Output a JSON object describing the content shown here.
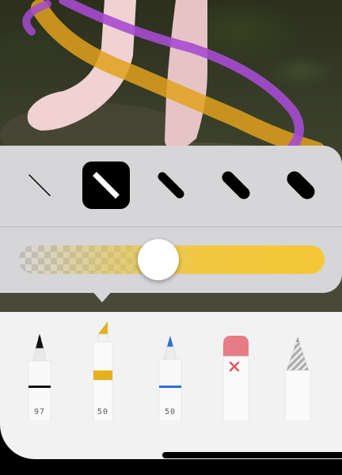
{
  "canvas": {
    "background": "photo-of-bare-feet-on-grass",
    "strokes": [
      {
        "name": "yellow-highlighter-stroke",
        "color": "#e0a21c"
      },
      {
        "name": "purple-marker-stroke",
        "color": "#a64bd2"
      }
    ]
  },
  "popover": {
    "widths": [
      {
        "name": "width-option-1",
        "selected": false
      },
      {
        "name": "width-option-2",
        "selected": true
      },
      {
        "name": "width-option-3",
        "selected": false
      },
      {
        "name": "width-option-4",
        "selected": false
      },
      {
        "name": "width-option-5",
        "selected": false
      }
    ],
    "opacity": {
      "value": 0.45,
      "color": "#f5c736"
    }
  },
  "tools": [
    {
      "name": "pen-tool",
      "label": "97",
      "color": "#111111"
    },
    {
      "name": "highlighter-tool",
      "label": "50",
      "color": "#e5b11f",
      "selected": true
    },
    {
      "name": "pencil-tool",
      "label": "50",
      "color": "#2f6fd6"
    },
    {
      "name": "eraser-tool",
      "label": "",
      "color": "#e57c86",
      "icon": "x-mark-icon"
    },
    {
      "name": "lasso-tool",
      "label": "",
      "color": "#b0b0b0"
    }
  ]
}
